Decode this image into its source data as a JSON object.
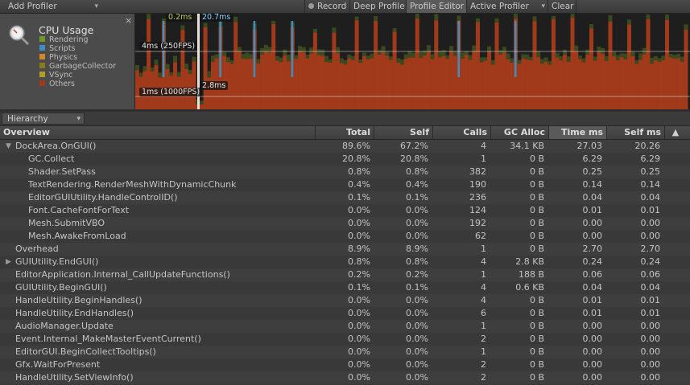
{
  "toolbar": {
    "add_profiler": "Add Profiler",
    "record": "Record",
    "deep_profile": "Deep Profile",
    "profile_editor": "Profile Editor",
    "active_profiler": "Active Profiler",
    "clear": "Clear"
  },
  "cpu_panel": {
    "title": "CPU Usage",
    "close": "×",
    "legend": [
      {
        "label": "Rendering",
        "color": "#6b9a2b"
      },
      {
        "label": "Scripts",
        "color": "#3d8fbf"
      },
      {
        "label": "Physics",
        "color": "#d3862a"
      },
      {
        "label": "GarbageCollector",
        "color": "#8a7a1e"
      },
      {
        "label": "VSync",
        "color": "#b59b27"
      },
      {
        "label": "Others",
        "color": "#a03a1a"
      }
    ]
  },
  "graph": {
    "cursor_top_left": "0.2ms",
    "cursor_top_right": "20.7ms",
    "cursor_mid": "2.8ms",
    "line_250": "4ms (250FPS)",
    "line_1000": "1ms (1000FPS)"
  },
  "view": {
    "mode": "Hierarchy"
  },
  "columns": [
    "Overview",
    "Total",
    "Self",
    "Calls",
    "GC Alloc",
    "Time ms",
    "Self ms"
  ],
  "rows": [
    {
      "name": "DockArea.OnGUI()",
      "indent": 0,
      "expand": "open",
      "total": "89.6%",
      "self": "67.2%",
      "calls": "4",
      "gc": "34.1 KB",
      "time": "27.03",
      "selfms": "20.26"
    },
    {
      "name": "GC.Collect",
      "indent": 1,
      "expand": "",
      "total": "20.8%",
      "self": "20.8%",
      "calls": "1",
      "gc": "0 B",
      "time": "6.29",
      "selfms": "6.29"
    },
    {
      "name": "Shader.SetPass",
      "indent": 1,
      "expand": "",
      "total": "0.8%",
      "self": "0.8%",
      "calls": "382",
      "gc": "0 B",
      "time": "0.25",
      "selfms": "0.25"
    },
    {
      "name": "TextRendering.RenderMeshWithDynamicChunk",
      "indent": 1,
      "expand": "",
      "total": "0.4%",
      "self": "0.4%",
      "calls": "190",
      "gc": "0 B",
      "time": "0.14",
      "selfms": "0.14"
    },
    {
      "name": "EditorGUIUtility.HandleControlID()",
      "indent": 1,
      "expand": "",
      "total": "0.1%",
      "self": "0.1%",
      "calls": "236",
      "gc": "0 B",
      "time": "0.04",
      "selfms": "0.04"
    },
    {
      "name": "Font.CacheFontForText",
      "indent": 1,
      "expand": "",
      "total": "0.0%",
      "self": "0.0%",
      "calls": "124",
      "gc": "0 B",
      "time": "0.01",
      "selfms": "0.01"
    },
    {
      "name": "Mesh.SubmitVBO",
      "indent": 1,
      "expand": "",
      "total": "0.0%",
      "self": "0.0%",
      "calls": "192",
      "gc": "0 B",
      "time": "0.00",
      "selfms": "0.00"
    },
    {
      "name": "Mesh.AwakeFromLoad",
      "indent": 1,
      "expand": "",
      "total": "0.0%",
      "self": "0.0%",
      "calls": "62",
      "gc": "0 B",
      "time": "0.00",
      "selfms": "0.00"
    },
    {
      "name": "Overhead",
      "indent": 0,
      "expand": "",
      "total": "8.9%",
      "self": "8.9%",
      "calls": "1",
      "gc": "0 B",
      "time": "2.70",
      "selfms": "2.70"
    },
    {
      "name": "GUIUtility.EndGUI()",
      "indent": 0,
      "expand": "closed",
      "total": "0.8%",
      "self": "0.8%",
      "calls": "4",
      "gc": "2.8 KB",
      "time": "0.24",
      "selfms": "0.24"
    },
    {
      "name": "EditorApplication.Internal_CallUpdateFunctions()",
      "indent": 0,
      "expand": "",
      "total": "0.2%",
      "self": "0.2%",
      "calls": "1",
      "gc": "188 B",
      "time": "0.06",
      "selfms": "0.06"
    },
    {
      "name": "GUIUtility.BeginGUI()",
      "indent": 0,
      "expand": "",
      "total": "0.1%",
      "self": "0.1%",
      "calls": "4",
      "gc": "0.6 KB",
      "time": "0.04",
      "selfms": "0.04"
    },
    {
      "name": "HandleUtility.BeginHandles()",
      "indent": 0,
      "expand": "",
      "total": "0.0%",
      "self": "0.0%",
      "calls": "4",
      "gc": "0 B",
      "time": "0.01",
      "selfms": "0.01"
    },
    {
      "name": "HandleUtility.EndHandles()",
      "indent": 0,
      "expand": "",
      "total": "0.0%",
      "self": "0.0%",
      "calls": "6",
      "gc": "0 B",
      "time": "0.01",
      "selfms": "0.01"
    },
    {
      "name": "AudioManager.Update",
      "indent": 0,
      "expand": "",
      "total": "0.0%",
      "self": "0.0%",
      "calls": "1",
      "gc": "0 B",
      "time": "0.00",
      "selfms": "0.00"
    },
    {
      "name": "Event.Internal_MakeMasterEventCurrent()",
      "indent": 0,
      "expand": "",
      "total": "0.0%",
      "self": "0.0%",
      "calls": "2",
      "gc": "0 B",
      "time": "0.00",
      "selfms": "0.00"
    },
    {
      "name": "EditorGUI.BeginCollectTooltips()",
      "indent": 0,
      "expand": "",
      "total": "0.0%",
      "self": "0.0%",
      "calls": "1",
      "gc": "0 B",
      "time": "0.00",
      "selfms": "0.00"
    },
    {
      "name": "Gfx.WaitForPresent",
      "indent": 0,
      "expand": "",
      "total": "0.0%",
      "self": "0.0%",
      "calls": "2",
      "gc": "0 B",
      "time": "0.00",
      "selfms": "0.00"
    },
    {
      "name": "HandleUtility.SetViewInfo()",
      "indent": 0,
      "expand": "",
      "total": "0.0%",
      "self": "0.0%",
      "calls": "2",
      "gc": "0 B",
      "time": "0.00",
      "selfms": "0.00"
    }
  ]
}
